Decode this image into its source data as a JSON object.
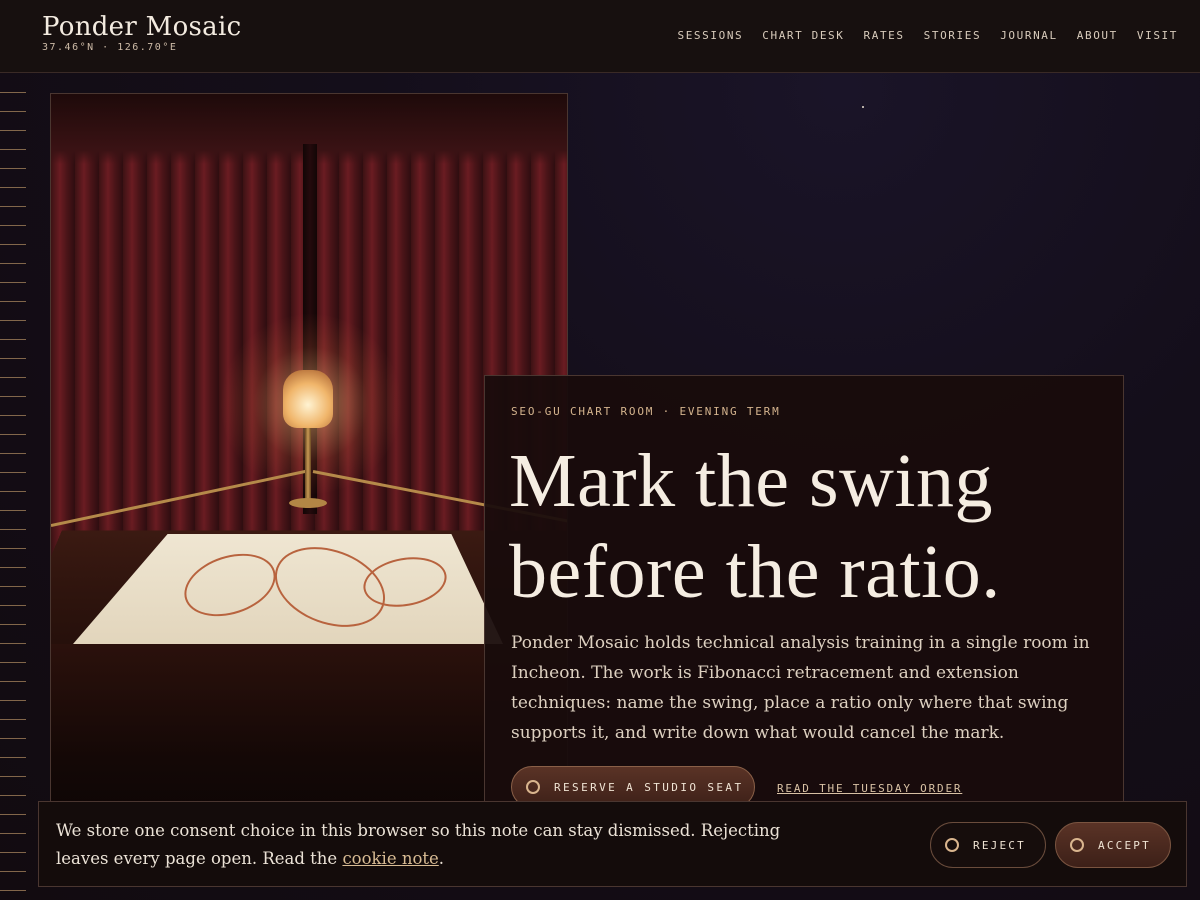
{
  "brand": {
    "name": "Ponder Mosaic",
    "coords": "37.46°N · 126.70°E"
  },
  "nav": [
    "SESSIONS",
    "CHART DESK",
    "RATES",
    "STORIES",
    "JOURNAL",
    "ABOUT",
    "VISIT"
  ],
  "hero": {
    "eyebrow": "SEO-GU CHART ROOM · EVENING TERM",
    "headline": "Mark the swing before the ratio.",
    "lede": "Ponder Mosaic holds technical analysis training in a single room in Incheon. The work is Fibonacci retracement and extension techniques: name the swing, place a ratio only where that swing supports it, and write down what would cancel the mark.",
    "cta_label": "RESERVE A STUDIO SEAT",
    "secondary_link": "READ THE TUESDAY ORDER"
  },
  "consent": {
    "text_before": "We store one consent choice in this browser so this note can stay dismissed. Rejecting leaves every page open. Read the ",
    "link": "cookie note",
    "text_after": ".",
    "reject_label": "REJECT",
    "accept_label": "ACCEPT"
  },
  "colors": {
    "accent": "#d9b58e",
    "background": "#120b10",
    "button": "#5a3326"
  }
}
